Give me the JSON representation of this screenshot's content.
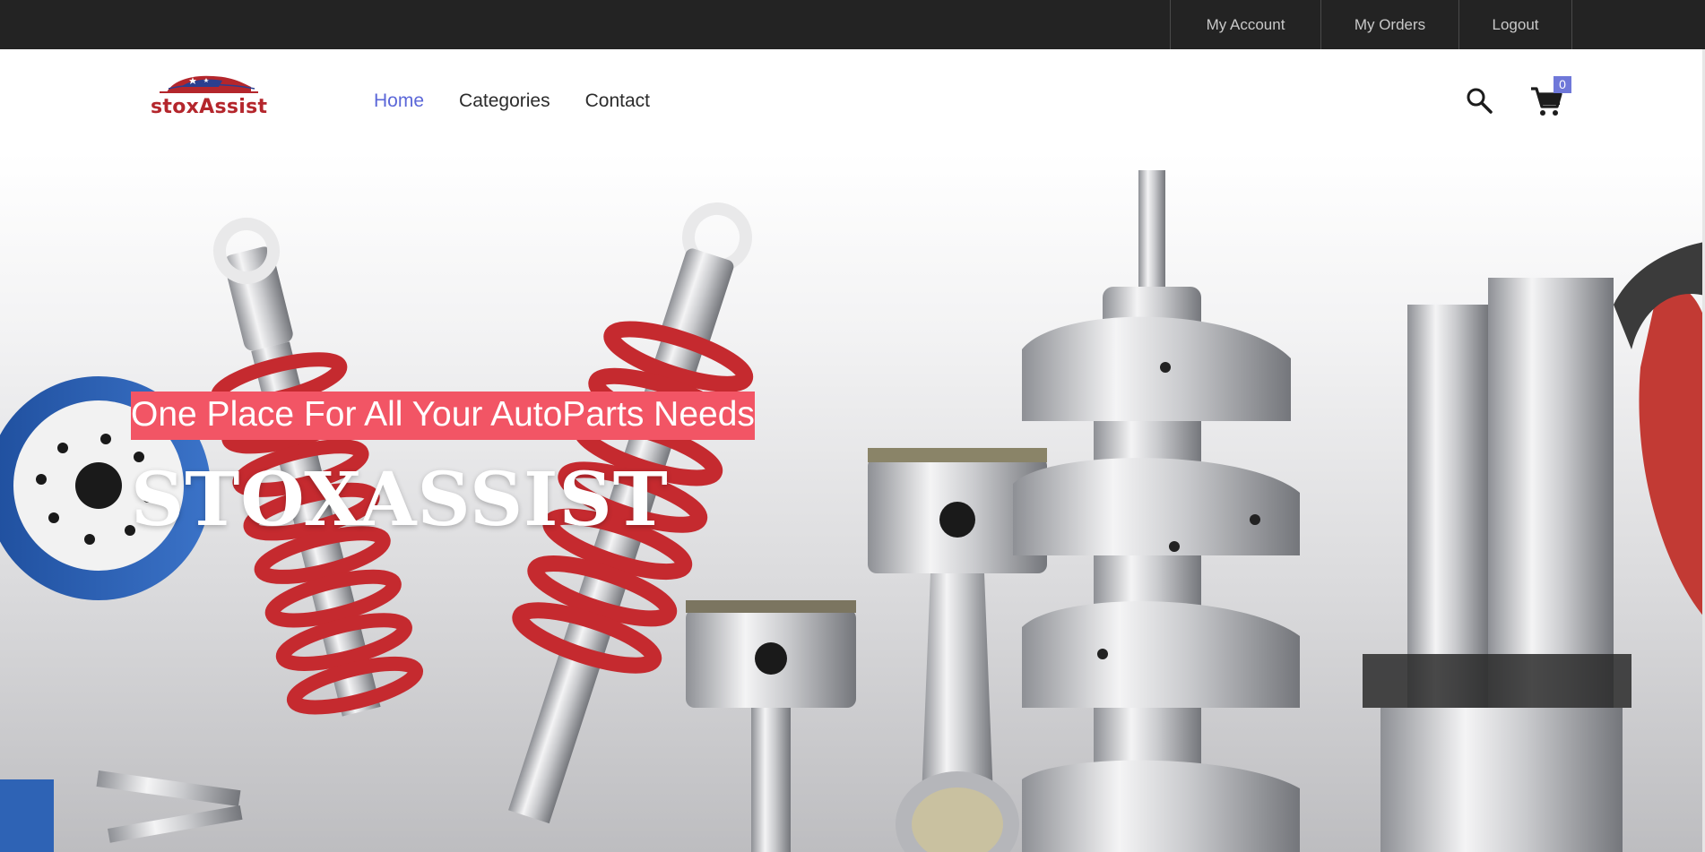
{
  "topbar": {
    "links": [
      "My Account",
      "My Orders",
      "Logout"
    ]
  },
  "header": {
    "logo_text": "stoxAssist",
    "nav": [
      {
        "label": "Home",
        "active": true
      },
      {
        "label": "Categories",
        "active": false
      },
      {
        "label": "Contact",
        "active": false
      }
    ],
    "cart_count": "0",
    "icons": [
      "search-icon",
      "cart-icon"
    ]
  },
  "hero": {
    "tagline": "One Place For All Your AutoParts Needs",
    "title": "STOXASSIST"
  },
  "colors": {
    "topbar_bg": "#232323",
    "nav_active": "#5b67d8",
    "logo_red": "#b4262c",
    "tagline_bg": "#f25565",
    "badge_bg": "#6f78d9"
  }
}
